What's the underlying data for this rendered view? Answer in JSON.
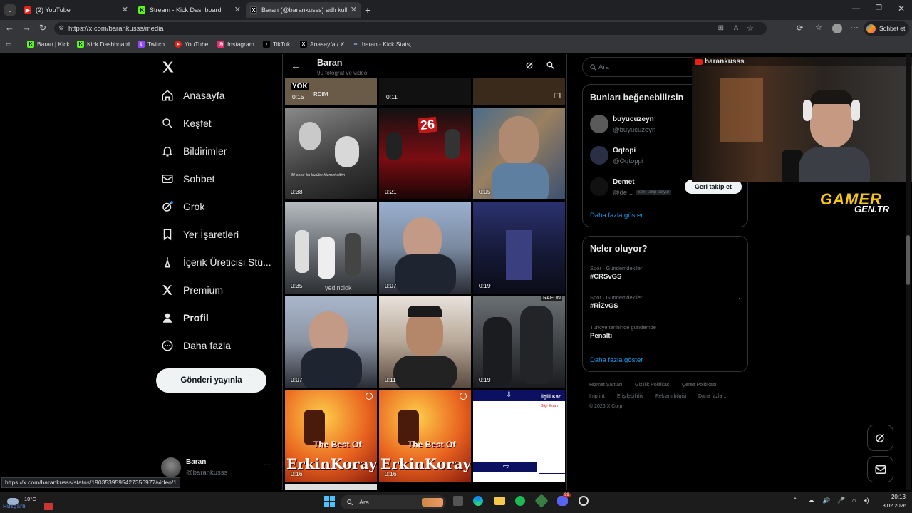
{
  "browser": {
    "tabs": [
      {
        "label": "(2) YouTube",
        "fav_color": "#e62117"
      },
      {
        "label": "Stream - Kick Dashboard",
        "fav_color": "#53fc18"
      },
      {
        "label": "Baran (@barankusss) adlı kullanıcı",
        "fav_color": "#ffffff"
      }
    ],
    "url": "https://x.com/barankusss/media",
    "profile_label": "Sohbet et",
    "bookmarks": [
      {
        "label": "Baran | Kick",
        "color": "#53fc18"
      },
      {
        "label": "Kick Dashboard",
        "color": "#53fc18"
      },
      {
        "label": "Twitch",
        "color": "#9146ff"
      },
      {
        "label": "YouTube",
        "color": "#e62117"
      },
      {
        "label": "Instagram",
        "color": "#e1306c"
      },
      {
        "label": "TikTok",
        "color": "#ffffff"
      },
      {
        "label": "Anasayfa / X",
        "color": "#ffffff"
      },
      {
        "label": "baran - Kick Stats,...",
        "color": "#8ab4f8"
      }
    ]
  },
  "sidebar": {
    "items": [
      {
        "label": "Anasayfa",
        "icon": "home-icon"
      },
      {
        "label": "Keşfet",
        "icon": "search-icon"
      },
      {
        "label": "Bildirimler",
        "icon": "bell-icon"
      },
      {
        "label": "Sohbet",
        "icon": "mail-icon"
      },
      {
        "label": "Grok",
        "icon": "grok-icon"
      },
      {
        "label": "Yer İşaretleri",
        "icon": "bookmark-icon"
      },
      {
        "label": "İçerik Üreticisi Stü...",
        "icon": "creator-icon"
      },
      {
        "label": "Premium",
        "icon": "x-icon"
      },
      {
        "label": "Profil",
        "icon": "person-icon"
      },
      {
        "label": "Daha fazla",
        "icon": "more-circle-icon"
      }
    ],
    "post_button": "Gönderi yayınla",
    "account_name": "Baran",
    "account_handle": "@barankusss",
    "account_more": "···"
  },
  "profile": {
    "name": "Baran",
    "subtitle": "90 fotoğraf ve video"
  },
  "media": {
    "top_row": [
      "0:15",
      "0:11",
      ""
    ],
    "grid": [
      {
        "dur": "0:38",
        "caption": "30 sene bu kulübe hizmet ettim",
        "bg": "#5a5a5a"
      },
      {
        "dur": "0:21",
        "caption": "",
        "bg": "#3a0b0b"
      },
      {
        "dur": "0:05",
        "caption": "",
        "bg": "#6b5a45"
      },
      {
        "dur": "0:35",
        "caption": "yedinciok",
        "bg": "#8a8f95"
      },
      {
        "dur": "0:07",
        "caption": "",
        "bg": "#5d6b80"
      },
      {
        "dur": "0:19",
        "caption": "",
        "bg": "#1d2240"
      },
      {
        "dur": "0:07",
        "caption": "",
        "bg": "#6a7283"
      },
      {
        "dur": "0:11",
        "caption": "",
        "bg": "#9a8f84"
      },
      {
        "dur": "0:19",
        "caption": "RAEON",
        "bg": "#4f5357"
      },
      {
        "dur": "0:16",
        "caption": "The Best Of",
        "bg": "#c9531e"
      },
      {
        "dur": "0:16",
        "caption": "The Best Of",
        "bg": "#c9531e"
      },
      {
        "dur": "",
        "caption": "İlgili Kar",
        "bg": "#ffffff"
      }
    ],
    "erkin_text": "ErkinKoray",
    "related_sub": "Bilgi Ekran"
  },
  "search": {
    "placeholder": "Ara"
  },
  "suggestions": {
    "title": "Bunları beğenebilirsin",
    "users": [
      {
        "name": "buyucuzeyn",
        "handle": "@buyucuzeyn",
        "badge": ""
      },
      {
        "name": "Oqtopi",
        "handle": "@Oqtoppi",
        "badge": ""
      },
      {
        "name": "Demet",
        "handle": "@de...",
        "badge": "Seni takip ediyor"
      }
    ],
    "follow_back": "Geri takip et",
    "show_more": "Daha fazla göster"
  },
  "trends": {
    "title": "Neler oluyor?",
    "items": [
      {
        "context": "Spor · Gündemdekiler",
        "name": "#CRSvGS"
      },
      {
        "context": "Spor · Gündemdekiler",
        "name": "#RİZvGS"
      },
      {
        "context": "Türkiye tarihinde gündemde",
        "name": "Penaltı"
      }
    ],
    "more_glyph": "···",
    "show_more": "Daha fazla göster"
  },
  "footer": {
    "row1": [
      "Hizmet Şartları",
      "Gizlilik Politikası",
      "Çerez Politikası"
    ],
    "row2": [
      "Imprint",
      "Erişilebilirlik",
      "Reklam bilgisi",
      "Daha fazla ..."
    ],
    "copyright": "© 2026 X Corp."
  },
  "overlay": {
    "channel": "barankusss",
    "brand_line1": "GAMER",
    "brand_line2": "GEN.TR"
  },
  "status_url": "https://x.com/barankusss/status/1903539595427356977/video/1",
  "taskbar": {
    "weather_temp": "10°C",
    "weather_desc": "Rüzgârlı",
    "search": "Ara",
    "time": "20:13",
    "date": "8.02.2026",
    "badge": "99"
  },
  "colors": {
    "accent": "#1d9bf0",
    "bg": "#000000",
    "border": "#2f3336",
    "muted": "#71767b"
  }
}
